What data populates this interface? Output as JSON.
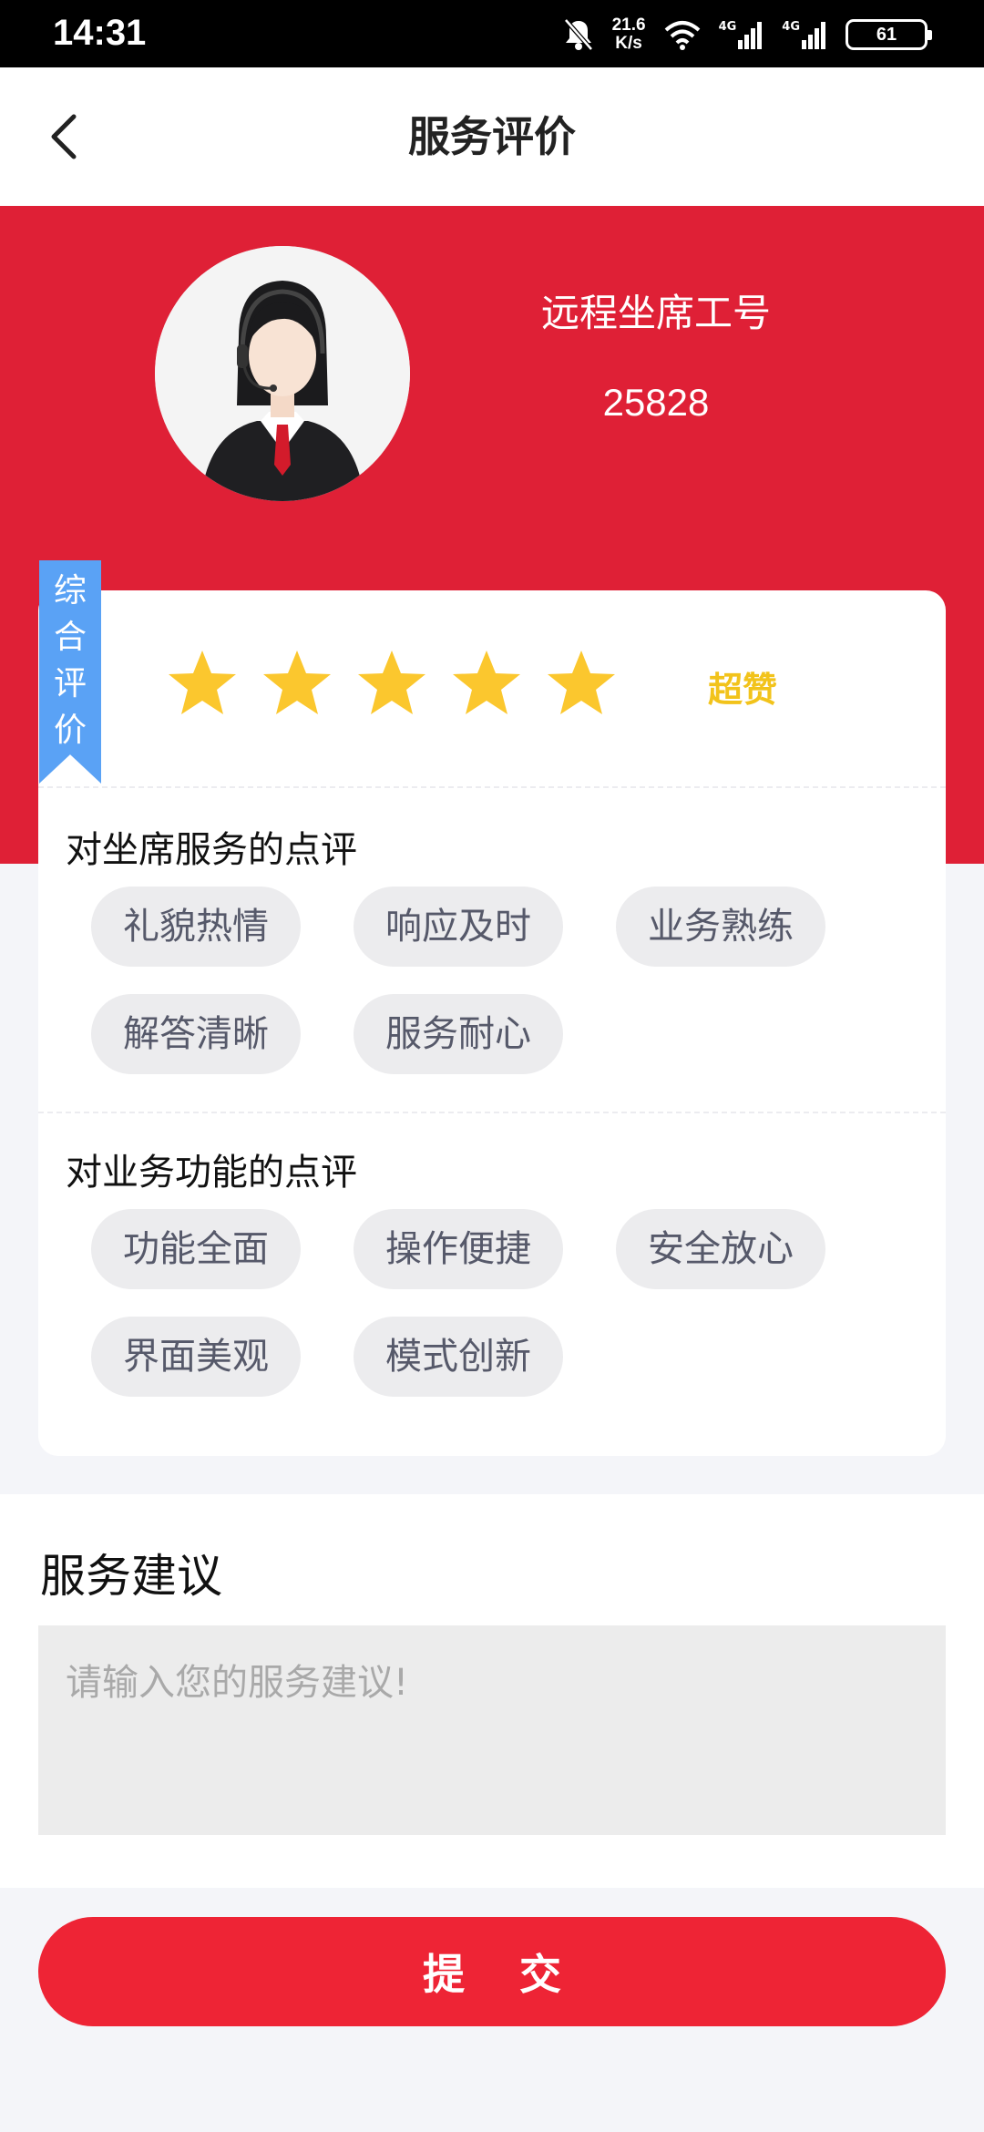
{
  "status_bar": {
    "time": "14:31",
    "net_speed_value": "21.6",
    "net_speed_unit": "K/s",
    "signal_1": "4G",
    "signal_2": "4G",
    "battery": "61"
  },
  "header": {
    "title": "服务评价"
  },
  "agent": {
    "label": "远程坐席工号",
    "id": "25828"
  },
  "rating": {
    "ribbon_chars": [
      "综",
      "合",
      "评",
      "价"
    ],
    "stars": 5,
    "max_stars": 5,
    "star_color": "#fbc72e",
    "text": "超赞"
  },
  "agent_review": {
    "title": "对坐席服务的点评",
    "tags": [
      "礼貌热情",
      "响应及时",
      "业务熟练",
      "解答清晰",
      "服务耐心"
    ]
  },
  "function_review": {
    "title": "对业务功能的点评",
    "tags": [
      "功能全面",
      "操作便捷",
      "安全放心",
      "界面美观",
      "模式创新"
    ]
  },
  "suggestion": {
    "title": "服务建议",
    "placeholder": "请输入您的服务建议!"
  },
  "submit": {
    "label": "提交"
  },
  "colors": {
    "brand_red": "#df2036",
    "button_red": "#ee2435",
    "ribbon_blue": "#5aa2f5",
    "rating_gold": "#f2c31b"
  }
}
